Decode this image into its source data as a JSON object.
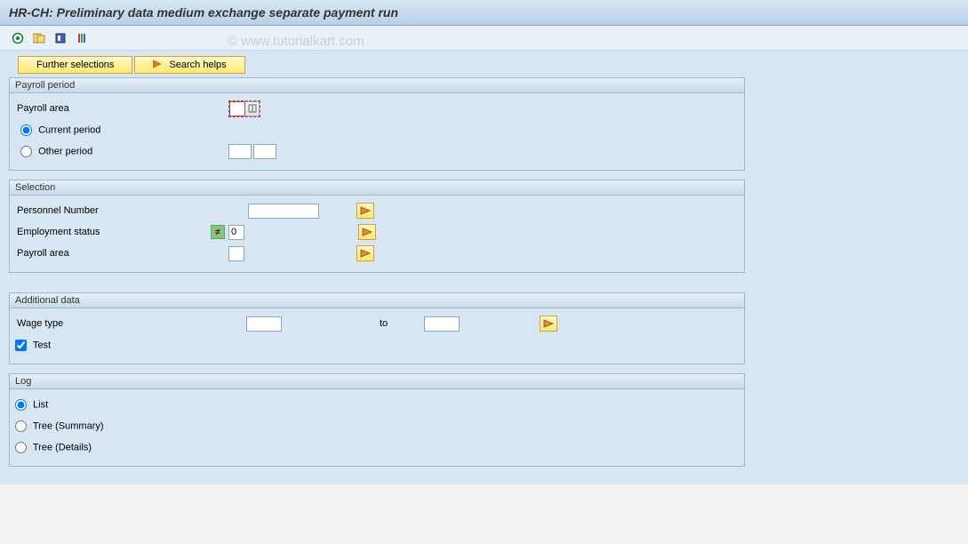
{
  "title": "HR-CH: Preliminary data medium exchange separate payment run",
  "watermark": "© www.tutorialkart.com",
  "buttons": {
    "further_selections": "Further selections",
    "search_helps": "Search helps"
  },
  "groups": {
    "payroll_period": {
      "title": "Payroll period",
      "payroll_area_label": "Payroll area",
      "payroll_area_value": "",
      "current_period_label": "Current period",
      "other_period_label": "Other period",
      "other_period_from": "",
      "other_period_to": "",
      "selected": "current"
    },
    "selection": {
      "title": "Selection",
      "personnel_number_label": "Personnel Number",
      "personnel_number_value": "",
      "employment_status_label": "Employment status",
      "employment_status_value": "0",
      "payroll_area_label": "Payroll area",
      "payroll_area_value": ""
    },
    "additional": {
      "title": "Additional data",
      "wage_type_label": "Wage type",
      "wage_type_from": "",
      "to_label": "to",
      "wage_type_to": "",
      "test_label": "Test",
      "test_checked": true
    },
    "log": {
      "title": "Log",
      "list_label": "List",
      "tree_summary_label": "Tree (Summary)",
      "tree_details_label": "Tree (Details)",
      "selected": "list"
    }
  }
}
